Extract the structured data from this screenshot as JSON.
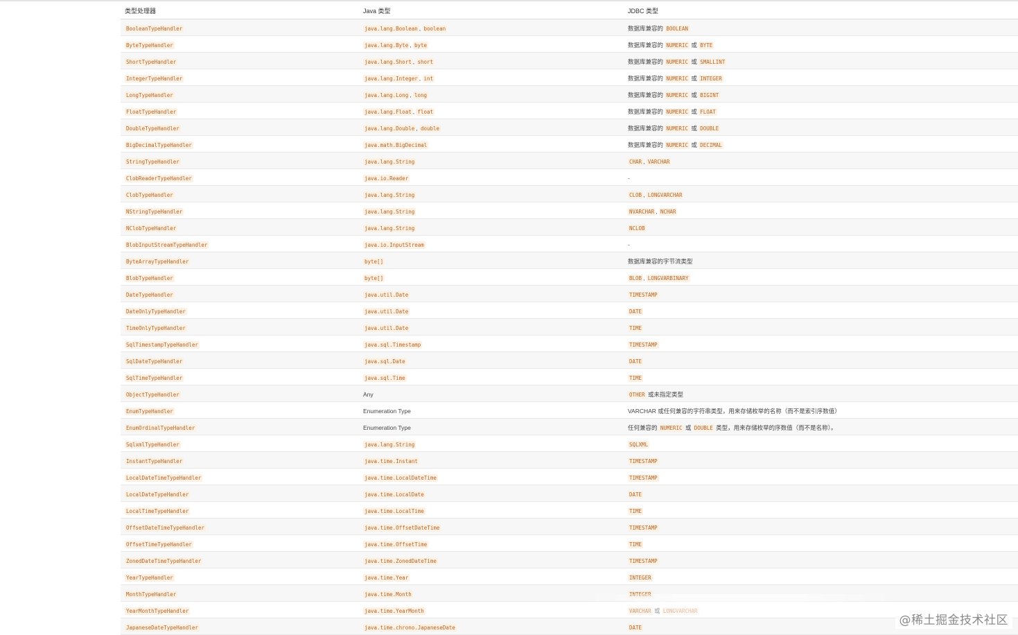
{
  "table": {
    "headers": [
      "类型处理器",
      "Java 类型",
      "JDBC 类型"
    ],
    "rows": [
      [
        {
          "t": "BooleanTypeHandler",
          "c": 1
        }
      ],
      [
        {
          "t": "java.lang.Boolean",
          "c": 1
        },
        {
          "t": ", "
        },
        {
          "t": "boolean",
          "c": 1
        }
      ],
      [
        {
          "t": "数据库兼容的 "
        },
        {
          "t": "BOOLEAN",
          "c": 1
        }
      ],
      [
        {
          "t": "ByteTypeHandler",
          "c": 1
        }
      ],
      [
        {
          "t": "java.lang.Byte",
          "c": 1
        },
        {
          "t": ", "
        },
        {
          "t": "byte",
          "c": 1
        }
      ],
      [
        {
          "t": "数据库兼容的 "
        },
        {
          "t": "NUMERIC",
          "c": 1
        },
        {
          "t": " 或 "
        },
        {
          "t": "BYTE",
          "c": 1
        }
      ],
      [
        {
          "t": "ShortTypeHandler",
          "c": 1
        }
      ],
      [
        {
          "t": "java.lang.Short",
          "c": 1
        },
        {
          "t": ", "
        },
        {
          "t": "short",
          "c": 1
        }
      ],
      [
        {
          "t": "数据库兼容的 "
        },
        {
          "t": "NUMERIC",
          "c": 1
        },
        {
          "t": " 或 "
        },
        {
          "t": "SMALLINT",
          "c": 1
        }
      ],
      [
        {
          "t": "IntegerTypeHandler",
          "c": 1
        }
      ],
      [
        {
          "t": "java.lang.Integer",
          "c": 1
        },
        {
          "t": ", "
        },
        {
          "t": "int",
          "c": 1
        }
      ],
      [
        {
          "t": "数据库兼容的 "
        },
        {
          "t": "NUMERIC",
          "c": 1
        },
        {
          "t": " 或 "
        },
        {
          "t": "INTEGER",
          "c": 1
        }
      ],
      [
        {
          "t": "LongTypeHandler",
          "c": 1
        }
      ],
      [
        {
          "t": "java.lang.Long",
          "c": 1
        },
        {
          "t": ", "
        },
        {
          "t": "long",
          "c": 1
        }
      ],
      [
        {
          "t": "数据库兼容的 "
        },
        {
          "t": "NUMERIC",
          "c": 1
        },
        {
          "t": " 或 "
        },
        {
          "t": "BIGINT",
          "c": 1
        }
      ],
      [
        {
          "t": "FloatTypeHandler",
          "c": 1
        }
      ],
      [
        {
          "t": "java.lang.Float",
          "c": 1
        },
        {
          "t": ", "
        },
        {
          "t": "float",
          "c": 1
        }
      ],
      [
        {
          "t": "数据库兼容的 "
        },
        {
          "t": "NUMERIC",
          "c": 1
        },
        {
          "t": " 或 "
        },
        {
          "t": "FLOAT",
          "c": 1
        }
      ],
      [
        {
          "t": "DoubleTypeHandler",
          "c": 1
        }
      ],
      [
        {
          "t": "java.lang.Double",
          "c": 1
        },
        {
          "t": ", "
        },
        {
          "t": "double",
          "c": 1
        }
      ],
      [
        {
          "t": "数据库兼容的 "
        },
        {
          "t": "NUMERIC",
          "c": 1
        },
        {
          "t": " 或 "
        },
        {
          "t": "DOUBLE",
          "c": 1
        }
      ],
      [
        {
          "t": "BigDecimalTypeHandler",
          "c": 1
        }
      ],
      [
        {
          "t": "java.math.BigDecimal",
          "c": 1
        }
      ],
      [
        {
          "t": "数据库兼容的 "
        },
        {
          "t": "NUMERIC",
          "c": 1
        },
        {
          "t": " 或 "
        },
        {
          "t": "DECIMAL",
          "c": 1
        }
      ],
      [
        {
          "t": "StringTypeHandler",
          "c": 1
        }
      ],
      [
        {
          "t": "java.lang.String",
          "c": 1
        }
      ],
      [
        {
          "t": "CHAR",
          "c": 1
        },
        {
          "t": ", "
        },
        {
          "t": "VARCHAR",
          "c": 1
        }
      ],
      [
        {
          "t": "ClobReaderTypeHandler",
          "c": 1
        }
      ],
      [
        {
          "t": "java.io.Reader",
          "c": 1
        }
      ],
      [
        {
          "t": "-"
        }
      ],
      [
        {
          "t": "ClobTypeHandler",
          "c": 1
        }
      ],
      [
        {
          "t": "java.lang.String",
          "c": 1
        }
      ],
      [
        {
          "t": "CLOB",
          "c": 1
        },
        {
          "t": ", "
        },
        {
          "t": "LONGVARCHAR",
          "c": 1
        }
      ],
      [
        {
          "t": "NStringTypeHandler",
          "c": 1
        }
      ],
      [
        {
          "t": "java.lang.String",
          "c": 1
        }
      ],
      [
        {
          "t": "NVARCHAR",
          "c": 1
        },
        {
          "t": ", "
        },
        {
          "t": "NCHAR",
          "c": 1
        }
      ],
      [
        {
          "t": "NClobTypeHandler",
          "c": 1
        }
      ],
      [
        {
          "t": "java.lang.String",
          "c": 1
        }
      ],
      [
        {
          "t": "NCLOB",
          "c": 1
        }
      ],
      [
        {
          "t": "BlobInputStreamTypeHandler",
          "c": 1
        }
      ],
      [
        {
          "t": "java.io.InputStream",
          "c": 1
        }
      ],
      [
        {
          "t": "-"
        }
      ],
      [
        {
          "t": "ByteArrayTypeHandler",
          "c": 1
        }
      ],
      [
        {
          "t": "byte[]",
          "c": 1
        }
      ],
      [
        {
          "t": "数据库兼容的字节流类型"
        }
      ],
      [
        {
          "t": "BlobTypeHandler",
          "c": 1
        }
      ],
      [
        {
          "t": "byte[]",
          "c": 1
        }
      ],
      [
        {
          "t": "BLOB",
          "c": 1
        },
        {
          "t": ", "
        },
        {
          "t": "LONGVARBINARY",
          "c": 1
        }
      ],
      [
        {
          "t": "DateTypeHandler",
          "c": 1
        }
      ],
      [
        {
          "t": "java.util.Date",
          "c": 1
        }
      ],
      [
        {
          "t": "TIMESTAMP",
          "c": 1
        }
      ],
      [
        {
          "t": "DateOnlyTypeHandler",
          "c": 1
        }
      ],
      [
        {
          "t": "java.util.Date",
          "c": 1
        }
      ],
      [
        {
          "t": "DATE",
          "c": 1
        }
      ],
      [
        {
          "t": "TimeOnlyTypeHandler",
          "c": 1
        }
      ],
      [
        {
          "t": "java.util.Date",
          "c": 1
        }
      ],
      [
        {
          "t": "TIME",
          "c": 1
        }
      ],
      [
        {
          "t": "SqlTimestampTypeHandler",
          "c": 1
        }
      ],
      [
        {
          "t": "java.sql.Timestamp",
          "c": 1
        }
      ],
      [
        {
          "t": "TIMESTAMP",
          "c": 1
        }
      ],
      [
        {
          "t": "SqlDateTypeHandler",
          "c": 1
        }
      ],
      [
        {
          "t": "java.sql.Date",
          "c": 1
        }
      ],
      [
        {
          "t": "DATE",
          "c": 1
        }
      ],
      [
        {
          "t": "SqlTimeTypeHandler",
          "c": 1
        }
      ],
      [
        {
          "t": "java.sql.Time",
          "c": 1
        }
      ],
      [
        {
          "t": "TIME",
          "c": 1
        }
      ],
      [
        {
          "t": "ObjectTypeHandler",
          "c": 1
        }
      ],
      [
        {
          "t": "Any"
        }
      ],
      [
        {
          "t": "OTHER",
          "c": 1
        },
        {
          "t": " 或未指定类型"
        }
      ],
      [
        {
          "t": "EnumTypeHandler",
          "c": 1
        }
      ],
      [
        {
          "t": "Enumeration Type"
        }
      ],
      [
        {
          "t": "VARCHAR 或任何兼容的字符串类型，用来存储枚举的名称（而不是索引序数值）"
        }
      ],
      [
        {
          "t": "EnumOrdinalTypeHandler",
          "c": 1
        }
      ],
      [
        {
          "t": "Enumeration Type"
        }
      ],
      [
        {
          "t": "任何兼容的 "
        },
        {
          "t": "NUMERIC",
          "c": 1
        },
        {
          "t": " 或 "
        },
        {
          "t": "DOUBLE",
          "c": 1
        },
        {
          "t": " 类型，用来存储枚举的序数值（而不是名称）。"
        }
      ],
      [
        {
          "t": "SqlxmlTypeHandler",
          "c": 1
        }
      ],
      [
        {
          "t": "java.lang.String",
          "c": 1
        }
      ],
      [
        {
          "t": "SQLXML",
          "c": 1
        }
      ],
      [
        {
          "t": "InstantTypeHandler",
          "c": 1
        }
      ],
      [
        {
          "t": "java.time.Instant",
          "c": 1
        }
      ],
      [
        {
          "t": "TIMESTAMP",
          "c": 1
        }
      ],
      [
        {
          "t": "LocalDateTimeTypeHandler",
          "c": 1
        }
      ],
      [
        {
          "t": "java.time.LocalDateTime",
          "c": 1
        }
      ],
      [
        {
          "t": "TIMESTAMP",
          "c": 1
        }
      ],
      [
        {
          "t": "LocalDateTypeHandler",
          "c": 1
        }
      ],
      [
        {
          "t": "java.time.LocalDate",
          "c": 1
        }
      ],
      [
        {
          "t": "DATE",
          "c": 1
        }
      ],
      [
        {
          "t": "LocalTimeTypeHandler",
          "c": 1
        }
      ],
      [
        {
          "t": "java.time.LocalTime",
          "c": 1
        }
      ],
      [
        {
          "t": "TIME",
          "c": 1
        }
      ],
      [
        {
          "t": "OffsetDateTimeTypeHandler",
          "c": 1
        }
      ],
      [
        {
          "t": "java.time.OffsetDateTime",
          "c": 1
        }
      ],
      [
        {
          "t": "TIMESTAMP",
          "c": 1
        }
      ],
      [
        {
          "t": "OffsetTimeTypeHandler",
          "c": 1
        }
      ],
      [
        {
          "t": "java.time.OffsetTime",
          "c": 1
        }
      ],
      [
        {
          "t": "TIME",
          "c": 1
        }
      ],
      [
        {
          "t": "ZonedDateTimeTypeHandler",
          "c": 1
        }
      ],
      [
        {
          "t": "java.time.ZonedDateTime",
          "c": 1
        }
      ],
      [
        {
          "t": "TIMESTAMP",
          "c": 1
        }
      ],
      [
        {
          "t": "YearTypeHandler",
          "c": 1
        }
      ],
      [
        {
          "t": "java.time.Year",
          "c": 1
        }
      ],
      [
        {
          "t": "INTEGER",
          "c": 1
        }
      ],
      [
        {
          "t": "MonthTypeHandler",
          "c": 1
        }
      ],
      [
        {
          "t": "java.time.Month",
          "c": 1
        }
      ],
      [
        {
          "t": "INTEGER",
          "c": 1
        }
      ],
      [
        {
          "t": "YearMonthTypeHandler",
          "c": 1
        }
      ],
      [
        {
          "t": "java.time.YearMonth",
          "c": 1
        }
      ],
      [
        {
          "t": "VARCHAR",
          "c": 1
        },
        {
          "t": " 或 "
        },
        {
          "t": "LONGVARCHAR",
          "c": 1
        }
      ],
      [
        {
          "t": "JapaneseDateTypeHandler",
          "c": 1
        }
      ],
      [
        {
          "t": "java.time.chrono.JapaneseDate",
          "c": 1
        }
      ],
      [
        {
          "t": "DATE",
          "c": 1
        }
      ]
    ]
  },
  "watermark": "@稀土掘金技术社区"
}
